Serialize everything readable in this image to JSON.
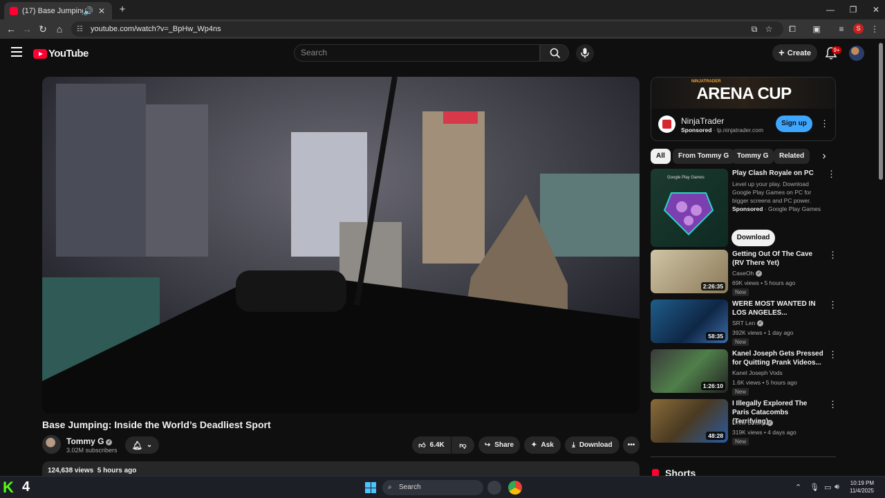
{
  "browser": {
    "tab_title": "(17) Base Jumping: Inside th",
    "url": "youtube.com/watch?v=_BpHw_Wp4ns",
    "profile_initial": "S"
  },
  "header": {
    "logo_text": "YouTube",
    "search_placeholder": "Search",
    "create_label": "Create",
    "notification_count": "9+"
  },
  "video": {
    "title": "Base Jumping: Inside the World’s Deadliest Sport",
    "channel": "Tommy G",
    "subscribers": "3.02M subscribers",
    "likes": "6.4K",
    "share_label": "Share",
    "ask_label": "Ask",
    "download_label": "Download",
    "views_line": "124,638 views  5 hours ago"
  },
  "sidebar": {
    "ad": {
      "banner": "ARENA CUP",
      "banner_kicker": "NINJATRADER",
      "advertiser": "NinjaTrader",
      "sponsored": "Sponsored",
      "domain": " · lp.ninjatrader.com",
      "cta": "Sign up"
    },
    "chips": [
      "All",
      "From Tommy G",
      "Tommy G",
      "Related"
    ],
    "promo": {
      "title": "Play Clash Royale on PC",
      "desc": "Level up your play. Download Google Play Games on PC for bigger screens and PC power.",
      "sponsored": "Sponsored",
      "advertiser": " · Google Play Games",
      "cta": "Download",
      "thumb_text": "Google Play Games"
    },
    "recs": [
      {
        "title": "Getting Out Of The Cave (RV There Yet)",
        "channel": "CaseOh",
        "meta": "69K views • 5 hours ago",
        "duration": "2:26:35",
        "badge": "New"
      },
      {
        "title": "WERE MOST WANTED IN LOS ANGELES...",
        "channel": "SRT Len",
        "meta": "392K views • 1 day ago",
        "duration": "58:35",
        "badge": "New"
      },
      {
        "title": "Kanel Joseph Gets Pressed for Quitting Prank Videos...",
        "channel": "Kanel Joseph Vods",
        "meta": "1.6K views • 5 hours ago",
        "duration": "1:26:10",
        "badge": "New"
      },
      {
        "title": "I Illegally Explored The Paris Catacombs (Terrifying)",
        "channel": "Drew Binsky",
        "meta": "319K views • 4 days ago",
        "duration": "48:28",
        "badge": "New"
      }
    ],
    "shorts_label": "Shorts"
  },
  "taskbar": {
    "kick_letter": "K",
    "kick_number": "4",
    "search_label": "Search",
    "time": "10:19 PM",
    "date": "11/4/2025"
  },
  "colors": {
    "accent_red": "#ff0033",
    "link_blue": "#3ea6ff",
    "background": "#0f0f0f"
  }
}
